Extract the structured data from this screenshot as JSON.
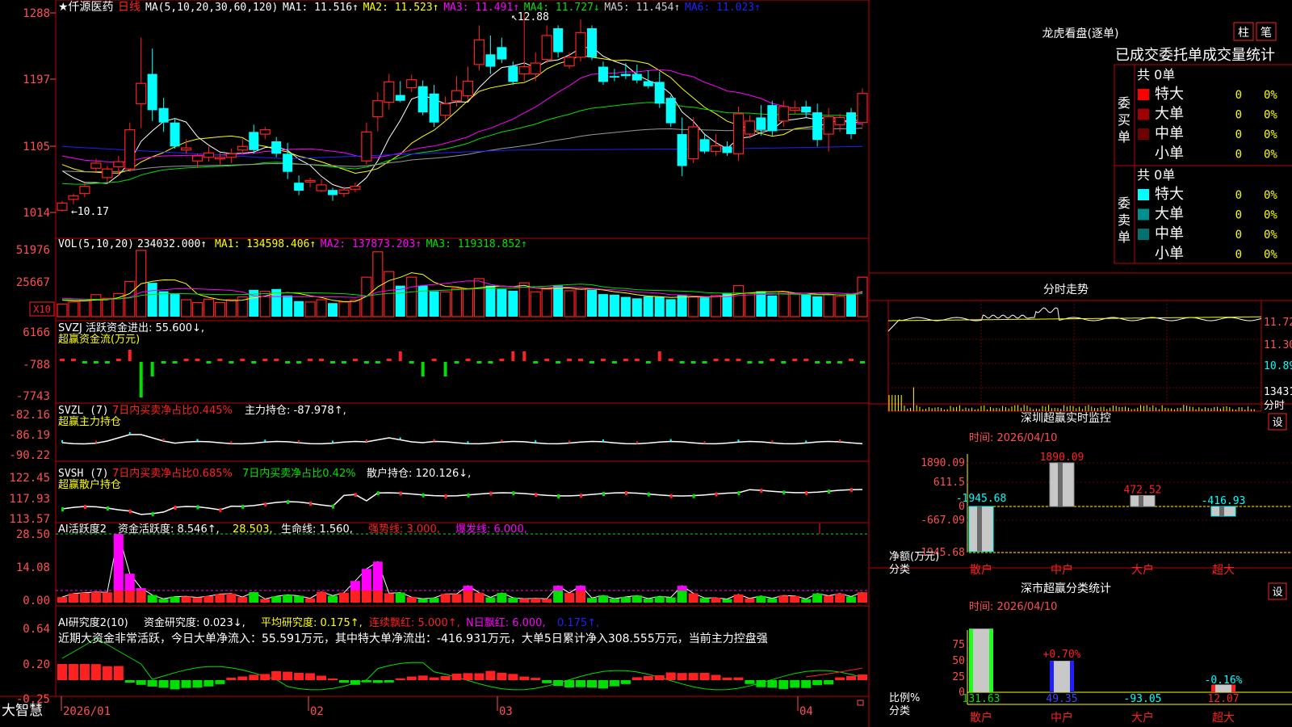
{
  "colors": {
    "up": "#ff2020",
    "down": "#00ffff",
    "frame": "#c00000",
    "grid": "#6a0000",
    "white": "#ffffff",
    "yellow": "#ffff00",
    "magenta": "#ff00ff",
    "green": "#00e000",
    "gray": "#9a9a9a",
    "blue": "#2020ff",
    "label": "#ff5050"
  },
  "stock": {
    "star": "★",
    "name": "仟源医药",
    "period": "日线"
  },
  "ma_line": {
    "prefix": "MA(5,10,20,30,60,120)",
    "items": [
      {
        "label": "MA1:",
        "value": "11.516",
        "arrow": "↑",
        "color": "#ffffff"
      },
      {
        "label": "MA2:",
        "value": "11.523",
        "arrow": "↑",
        "color": "#ffff00"
      },
      {
        "label": "MA3:",
        "value": "11.491",
        "arrow": "↑",
        "color": "#ff00ff"
      },
      {
        "label": "MA4:",
        "value": "11.727",
        "arrow": "↓",
        "color": "#00e000"
      },
      {
        "label": "MA5:",
        "value": "11.454",
        "arrow": "↑",
        "color": "#cccccc"
      },
      {
        "label": "MA6:",
        "value": "11.023",
        "arrow": "↑",
        "color": "#2020ff"
      }
    ]
  },
  "price_axis": [
    "1288",
    "1197",
    "1105",
    "1014"
  ],
  "high_label": "12.88",
  "low_label": "10.17",
  "vol_line": {
    "prefix": "VOL(5,10,20)",
    "value": "234032.000",
    "arrow": "↑",
    "items": [
      {
        "label": "MA1:",
        "value": "134598.406",
        "arrow": "↑",
        "color": "#ffff00"
      },
      {
        "label": "MA2:",
        "value": "137873.203",
        "arrow": "↑",
        "color": "#ff00ff"
      },
      {
        "label": "MA3:",
        "value": "119318.852",
        "arrow": "↑",
        "color": "#00e000"
      }
    ]
  },
  "vol_axis": [
    "51976",
    "25667"
  ],
  "vol_unit": "X10",
  "svzj": {
    "line1": "SVZJ  活跃资金进出: 55.600↓,",
    "line2": "超赢资金流(万元)",
    "axis": [
      "6166",
      "-788",
      "-7743"
    ]
  },
  "svzl": {
    "line1_a": "SVZL (7)",
    "line1_b": "7日内买卖净占比0.445%",
    "line1_c": "主力持仓: -87.978↑,",
    "line2": "超赢主力持仓",
    "axis": [
      "-82.16",
      "-86.19",
      "-90.22"
    ]
  },
  "svsh": {
    "line1_a": "SVSH (7)",
    "line1_b": "7日内买卖净占比0.685%",
    "line1_c": "7日内买卖净占比0.42%",
    "line1_d": "散户持仓: 120.126↓,",
    "line2": "超赢散户持仓",
    "axis": [
      "122.45",
      "117.93",
      "113.57"
    ]
  },
  "ai_active": {
    "a": "AI活跃度2",
    "b": "资金活跃度: 8.546↑,",
    "c": "28.503,",
    "d": "生命线: 1.560,",
    "e": "强势线: 3.000,",
    "f": "爆发线: 6.000,",
    "axis": [
      "28.50",
      "14.08",
      "0.00"
    ]
  },
  "ai_research": {
    "a": "AI研究度2(10)",
    "b": "资金研究度: 0.023↓,",
    "c": "平均研究度: 0.175↑,",
    "d": "连续飘红: 5.000↑,",
    "e": "N日飘红: 6.000,",
    "f": "0.175↑,",
    "desc": "近期大资金非常活跃，今日大单净流入：55.591万元，其中特大单净流出：-416.931万元，大单5日累计净入308.555万元，当前主力控盘强",
    "axis": [
      "0.64",
      "0.20",
      "-0.25"
    ]
  },
  "date_axis": [
    "2026/01",
    "02",
    "03",
    "04"
  ],
  "logo": "大智慧",
  "dragon": {
    "title": "龙虎看盘(逐单)",
    "btn1": "柱",
    "btn2": "笔",
    "subtitle": "已成交委托单成交量统计",
    "buy_label": "委买单",
    "sell_label": "委卖单",
    "buy_total": "共 0单",
    "sell_total": "共 0单",
    "buy_rows": [
      {
        "name": "特大",
        "v": "0",
        "p": "0%",
        "c": "#ff0000"
      },
      {
        "name": "大单",
        "v": "0",
        "p": "0%",
        "c": "#a00000"
      },
      {
        "name": "中单",
        "v": "0",
        "p": "0%",
        "c": "#700000"
      },
      {
        "name": "小单",
        "v": "0",
        "p": "0%",
        "c": ""
      }
    ],
    "sell_rows": [
      {
        "name": "特大",
        "v": "0",
        "p": "0%",
        "c": "#00ffff"
      },
      {
        "name": "大单",
        "v": "0",
        "p": "0%",
        "c": "#009090"
      },
      {
        "name": "中单",
        "v": "0",
        "p": "0%",
        "c": "#007070"
      },
      {
        "name": "小单",
        "v": "0",
        "p": "0%",
        "c": ""
      }
    ]
  },
  "intraday": {
    "title": "分时走势",
    "axis": [
      "11.72",
      "11.30",
      "10.89"
    ],
    "vol": "13431",
    "unit": "分时"
  },
  "sz_monitor": {
    "title": "深圳超赢实时监控",
    "btn": "设",
    "time": "时间: 2026/04/10",
    "axis": [
      "1890.09",
      "611.5",
      "0",
      "-667.09",
      "-1945.68"
    ],
    "ylabel": "净额(万元)",
    "xlabel": "分类",
    "bars": [
      {
        "cat": "散户",
        "value": -1945.68,
        "label": "-1945.68"
      },
      {
        "cat": "中户",
        "value": 1890.09,
        "label": "1890.09"
      },
      {
        "cat": "大户",
        "value": 472.52,
        "label": "472.52"
      },
      {
        "cat": "超大",
        "value": -416.93,
        "label": "-416.93"
      }
    ]
  },
  "sz_class": {
    "title": "深市超赢分类统计",
    "btn": "设",
    "time": "时间: 2026/04/10",
    "axis": [
      "75",
      "50",
      "25",
      "0"
    ],
    "ylabel": "比例%",
    "xlabel": "分类",
    "bars": [
      {
        "cat": "散户",
        "value": 131.63,
        "top": "",
        "bottom": "131.63"
      },
      {
        "cat": "中户",
        "value": 49.35,
        "top": "+0.70%",
        "bottom": "49.35"
      },
      {
        "cat": "大户",
        "value": -93.05,
        "top": "",
        "bottom": "-93.05"
      },
      {
        "cat": "超大",
        "value": 12.07,
        "top": "-0.16%",
        "bottom": "12.07"
      }
    ]
  },
  "chart_data": {
    "type": "candlestick",
    "ohlc": [
      [
        10.17,
        10.3,
        10.15,
        10.27
      ],
      [
        10.32,
        10.4,
        10.25,
        10.37
      ],
      [
        10.4,
        10.55,
        10.35,
        10.5
      ],
      [
        10.75,
        10.88,
        10.7,
        10.82
      ],
      [
        10.62,
        10.78,
        10.55,
        10.74
      ],
      [
        10.77,
        10.92,
        10.65,
        10.84
      ],
      [
        10.74,
        11.38,
        10.7,
        11.28
      ],
      [
        11.64,
        12.55,
        11.3,
        11.92
      ],
      [
        12.05,
        12.4,
        11.4,
        11.55
      ],
      [
        11.58,
        11.72,
        11.25,
        11.38
      ],
      [
        11.38,
        11.44,
        11.02,
        11.05
      ],
      [
        11.0,
        11.15,
        10.95,
        11.03
      ],
      [
        10.85,
        10.95,
        10.75,
        10.92
      ],
      [
        10.9,
        11.05,
        10.84,
        10.96
      ],
      [
        10.88,
        10.96,
        10.8,
        10.9
      ],
      [
        10.9,
        11.02,
        10.82,
        10.95
      ],
      [
        11.0,
        11.15,
        10.95,
        11.05
      ],
      [
        11.25,
        11.35,
        10.95,
        11.0
      ],
      [
        11.22,
        11.32,
        11.15,
        11.28
      ],
      [
        11.12,
        11.18,
        10.9,
        10.95
      ],
      [
        10.95,
        11.1,
        10.6,
        10.7
      ],
      [
        10.55,
        10.65,
        10.38,
        10.44
      ],
      [
        10.56,
        10.62,
        10.48,
        10.58
      ],
      [
        10.44,
        10.6,
        10.42,
        10.52
      ],
      [
        10.45,
        10.48,
        10.3,
        10.38
      ],
      [
        10.4,
        10.5,
        10.35,
        10.45
      ],
      [
        10.46,
        10.55,
        10.42,
        10.5
      ],
      [
        10.85,
        11.38,
        10.8,
        11.25
      ],
      [
        11.46,
        11.8,
        11.26,
        11.68
      ],
      [
        11.66,
        12.05,
        11.56,
        11.94
      ],
      [
        11.76,
        11.95,
        11.66,
        11.68
      ],
      [
        11.86,
        12.04,
        11.8,
        11.97
      ],
      [
        11.88,
        11.96,
        11.48,
        11.52
      ],
      [
        11.78,
        11.9,
        11.32,
        11.38
      ],
      [
        11.48,
        11.74,
        11.4,
        11.64
      ],
      [
        11.68,
        12.02,
        11.6,
        11.82
      ],
      [
        11.75,
        12.15,
        11.7,
        11.95
      ],
      [
        12.18,
        12.72,
        12.1,
        12.52
      ],
      [
        12.32,
        12.58,
        12.05,
        12.15
      ],
      [
        12.42,
        12.55,
        12.2,
        12.25
      ],
      [
        12.16,
        12.22,
        11.9,
        11.94
      ],
      [
        12.05,
        12.88,
        11.95,
        12.15
      ],
      [
        12.05,
        12.35,
        11.95,
        12.2
      ],
      [
        12.25,
        12.72,
        12.2,
        12.58
      ],
      [
        12.68,
        12.72,
        12.28,
        12.35
      ],
      [
        12.16,
        12.35,
        12.12,
        12.28
      ],
      [
        12.28,
        12.8,
        12.22,
        12.62
      ],
      [
        12.68,
        12.72,
        12.24,
        12.28
      ],
      [
        12.15,
        12.22,
        11.9,
        11.94
      ],
      [
        12.02,
        12.12,
        11.95,
        12.0
      ],
      [
        12.05,
        12.2,
        11.98,
        12.02
      ],
      [
        12.05,
        12.18,
        11.92,
        11.96
      ],
      [
        11.95,
        12.1,
        11.85,
        11.88
      ],
      [
        11.94,
        12.08,
        11.58,
        11.64
      ],
      [
        11.72,
        11.75,
        11.32,
        11.37
      ],
      [
        11.22,
        11.45,
        10.64,
        10.78
      ],
      [
        10.88,
        11.45,
        10.82,
        11.32
      ],
      [
        11.15,
        11.22,
        10.95,
        10.98
      ],
      [
        10.98,
        11.22,
        10.92,
        11.06
      ],
      [
        11.05,
        11.12,
        10.92,
        10.96
      ],
      [
        10.95,
        11.6,
        10.85,
        11.5
      ],
      [
        11.22,
        11.48,
        11.16,
        11.4
      ],
      [
        11.45,
        11.62,
        11.2,
        11.28
      ],
      [
        11.62,
        11.68,
        11.2,
        11.26
      ],
      [
        11.4,
        11.68,
        11.32,
        11.6
      ],
      [
        11.55,
        11.68,
        11.5,
        11.58
      ],
      [
        11.6,
        11.68,
        11.45,
        11.52
      ],
      [
        11.52,
        11.64,
        11.05,
        11.14
      ],
      [
        11.22,
        11.58,
        10.98,
        11.46
      ],
      [
        11.35,
        11.5,
        11.25,
        11.45
      ],
      [
        11.52,
        11.58,
        11.15,
        11.22
      ],
      [
        11.38,
        11.85,
        11.32,
        11.78
      ]
    ],
    "volume": [
      45000,
      52000,
      60000,
      78000,
      65000,
      82000,
      125000,
      235000,
      120000,
      90000,
      80000,
      60000,
      50000,
      62000,
      50000,
      60000,
      70000,
      95000,
      90000,
      98000,
      75000,
      55000,
      52000,
      60000,
      48000,
      52000,
      58000,
      140000,
      230000,
      160000,
      110000,
      140000,
      110000,
      90000,
      88000,
      100000,
      100000,
      135000,
      110000,
      98000,
      92000,
      120000,
      88000,
      98000,
      110000,
      92000,
      98000,
      95000,
      80000,
      78000,
      70000,
      65000,
      72000,
      70000,
      62000,
      78000,
      70000,
      68000,
      75000,
      82000,
      110000,
      85000,
      90000,
      75000,
      88000,
      82000,
      80000,
      72000,
      78000,
      72000,
      82000,
      140000
    ],
    "ylim": [
      10.14,
      12.88
    ],
    "x_ticks": [
      "2026/01",
      "02",
      "03",
      "04"
    ],
    "sz_monitor_values": [
      -1945.68,
      1890.09,
      472.52,
      -416.93
    ],
    "sz_class_values": [
      131.63,
      49.35,
      -93.05,
      12.07
    ]
  }
}
